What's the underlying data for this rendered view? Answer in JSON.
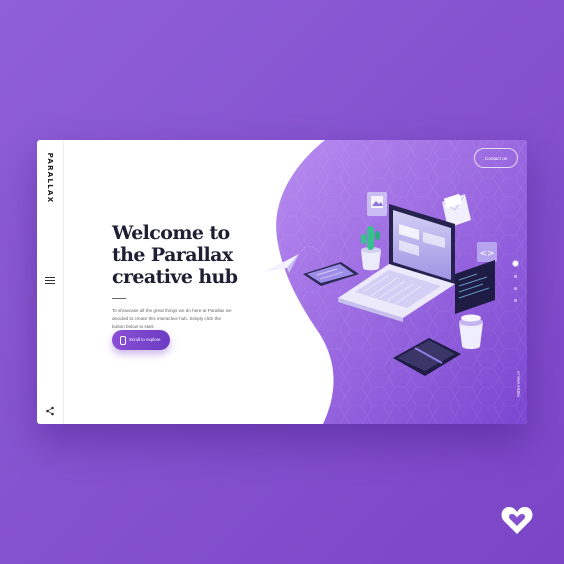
{
  "brand": {
    "logo_text": "PARALLAX"
  },
  "hero": {
    "title": "Welcome to the Parallax creative hub",
    "description": "To showcase all the great things we do here at Parallax we decided to create this interactive hub. Simply click the button below to start.",
    "cta_label": "Scroll to explore"
  },
  "header": {
    "contact_label": "Contact us"
  },
  "side": {
    "email": "hi@parallax.co"
  },
  "colors": {
    "accent": "#8b4fd6",
    "background": "#8552cf",
    "card": "#ffffff"
  }
}
